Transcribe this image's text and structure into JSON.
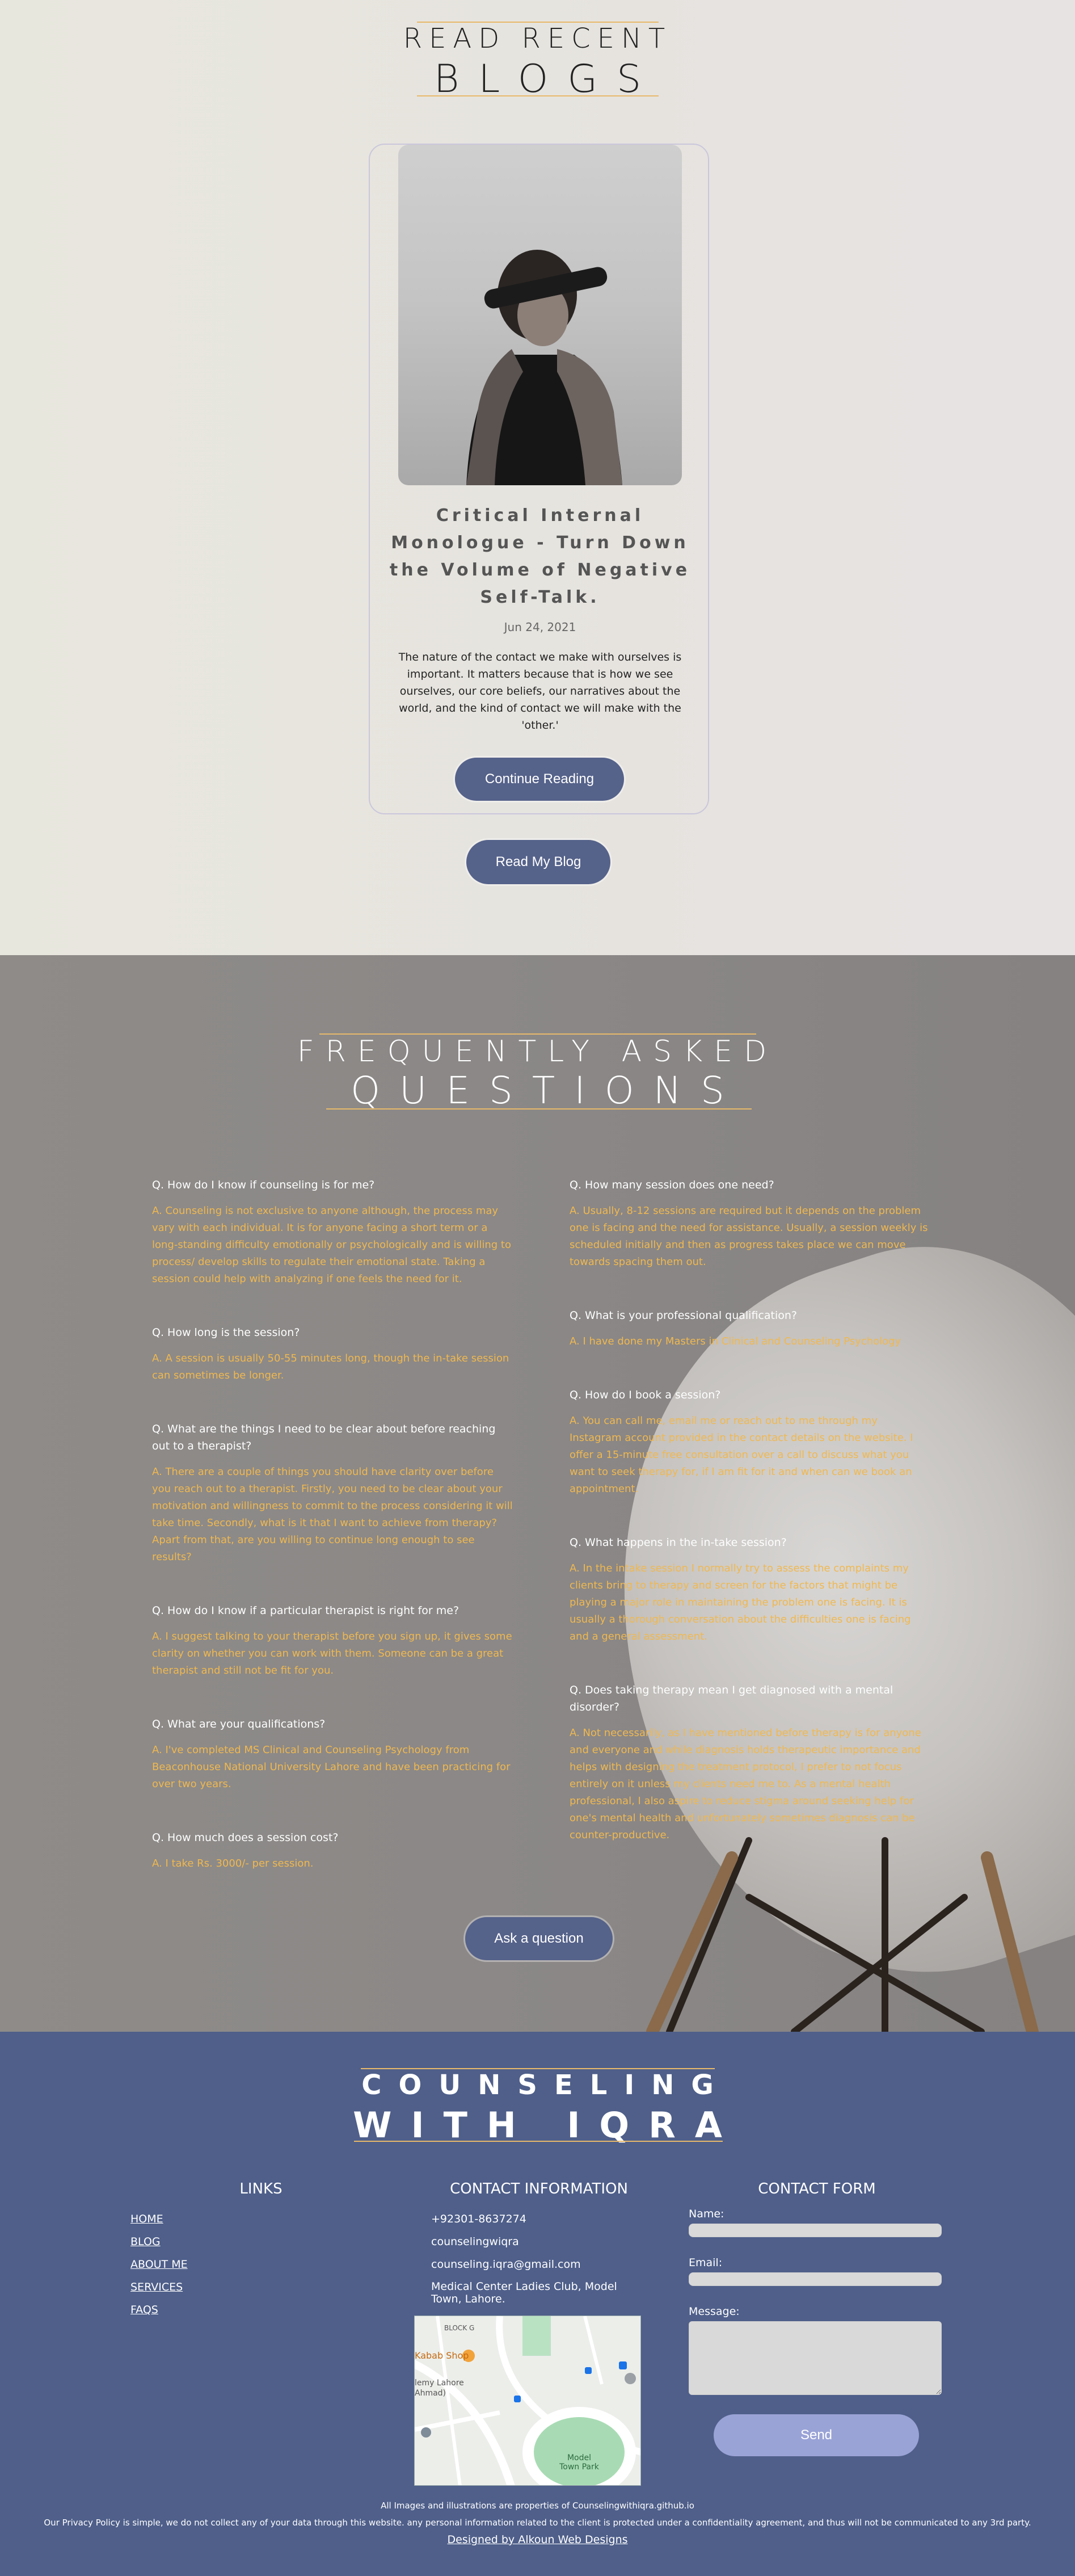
{
  "blog": {
    "heading_top": "READ RECENT",
    "heading_bottom": "BLOGS",
    "post": {
      "title": "Critical Internal Monologue - Turn Down the Volume of Negative Self-Talk.",
      "date": "Jun 24, 2021",
      "excerpt": "The nature of the contact we make with ourselves is important. It matters because that is how we see ourselves, our core beliefs, our narratives about the world, and the kind of contact we will make with the 'other.'",
      "button": "Continue Reading"
    },
    "read_blog_button": "Read My Blog"
  },
  "faq": {
    "heading_top": "FREQUENTLY ASKED",
    "heading_bottom": "QUESTIONS",
    "left": [
      {
        "q": "Q. How do I know if counseling is for me?",
        "a": "A. Counseling is not exclusive to anyone although, the process may vary with each individual. It is for anyone facing a short term or a long-standing difficulty emotionally or psychologically and is willing to process/ develop skills to regulate their emotional state. Taking a session could help with analyzing if one feels the need for it."
      },
      {
        "q": "Q. How long is the session?",
        "a": "A. A session is usually 50-55 minutes long, though the in-take session can sometimes be longer."
      },
      {
        "q": "Q. What are the things I need to be clear about before reaching out to a therapist?",
        "a": "A. There are a couple of things you should have clarity over before you reach out to a therapist. Firstly, you need to be clear about your motivation and willingness to commit to the process considering it will take time. Secondly, what is it that I want to achieve from therapy? Apart from that, are you willing to continue long enough to see results?"
      },
      {
        "q": "Q. How do I know if a particular therapist is right for me?",
        "a": "A. I suggest talking to your therapist before you sign up, it gives some clarity on whether you can work with them. Someone can be a great therapist and still not be fit for you."
      },
      {
        "q": "Q. What are your qualifications?",
        "a": "A. I've completed MS Clinical and Counseling Psychology from Beaconhouse National University Lahore and have been practicing for over two years."
      },
      {
        "q": "Q. How much does a session cost?",
        "a": "A. I take Rs. 3000/- per session."
      }
    ],
    "right": [
      {
        "q": "Q. How many session does one need?",
        "a": "A. Usually, 8-12 sessions are required but it depends on the problem one is facing and the need for assistance. Usually, a session weekly is scheduled initially and then as progress takes place we can move towards spacing them out."
      },
      {
        "q": "Q. What is your professional qualification?",
        "a": "A. I have done my Masters in Clinical and Counseling Psychology"
      },
      {
        "q": "Q. How do I book a session?",
        "a": "A. You can call me, email me or reach out to me through my Instagram account provided in the contact details on the website. I offer a 15-minute free consultation over a call to discuss what you want to seek therapy for, if I am fit for it and when can we book an appointment."
      },
      {
        "q": "Q. What happens in the in-take session?",
        "a": "A. In the intake session I normally try to assess the complaints my clients bring to therapy and screen for the factors that might be playing a major role in maintaining the problem one is facing. It is usually a thorough conversation about the difficulties one is facing and a general assessment."
      },
      {
        "q": "Q. Does taking therapy mean I get diagnosed with a mental disorder?",
        "a": "A. Not necessarily, as I have mentioned before therapy is for anyone and everyone and while diagnosis holds therapeutic importance and helps with designing the treatment protocol, I prefer to not focus entirely on it unless my clients need me to. As a mental health professional, I also aspire to reduce stigma around seeking help for one's mental health and unfortunately sometimes diagnosis can be counter-productive."
      }
    ],
    "ask_button": "Ask a question"
  },
  "footer": {
    "heading_top": "COUNSELING",
    "heading_bottom": "WITH IQRA",
    "links_title": "LINKS",
    "links": [
      "HOME",
      "BLOG",
      "ABOUT ME",
      "SERVICES",
      "FAQS"
    ],
    "contact_title": "CONTACT INFORMATION",
    "phone": "+92301-8637274",
    "instagram": "counselingwiqra",
    "email": "counseling.iqra@gmail.com",
    "address": "Medical Center Ladies Club, Model Town, Lahore.",
    "map_labels": {
      "block": "BLOCK G",
      "shop": "Kabab Shop",
      "academy": "lemy Lahore",
      "ahmad": "Ahmad)",
      "park": "Model Town Park"
    },
    "form_title": "CONTACT FORM",
    "form_name": "Name:",
    "form_email": "Email:",
    "form_message": "Message:",
    "send": "Send",
    "note_images": "All Images and illustrations are properties of Counselingwithiqra.github.io",
    "note_privacy": "Our Privacy Policy is simple, we do not collect any of your data through this website. any personal information related to the client is protected under a confidentiality agreement, and thus will not be communicated to any 3rd party.",
    "designed_by": "Designed by Alkoun Web Designs"
  },
  "colors": {
    "accent_gold": "#e8b96a",
    "button_blue": "#55628a",
    "footer_bg": "#4f5f8a",
    "answer_orange": "#f0b84f"
  }
}
